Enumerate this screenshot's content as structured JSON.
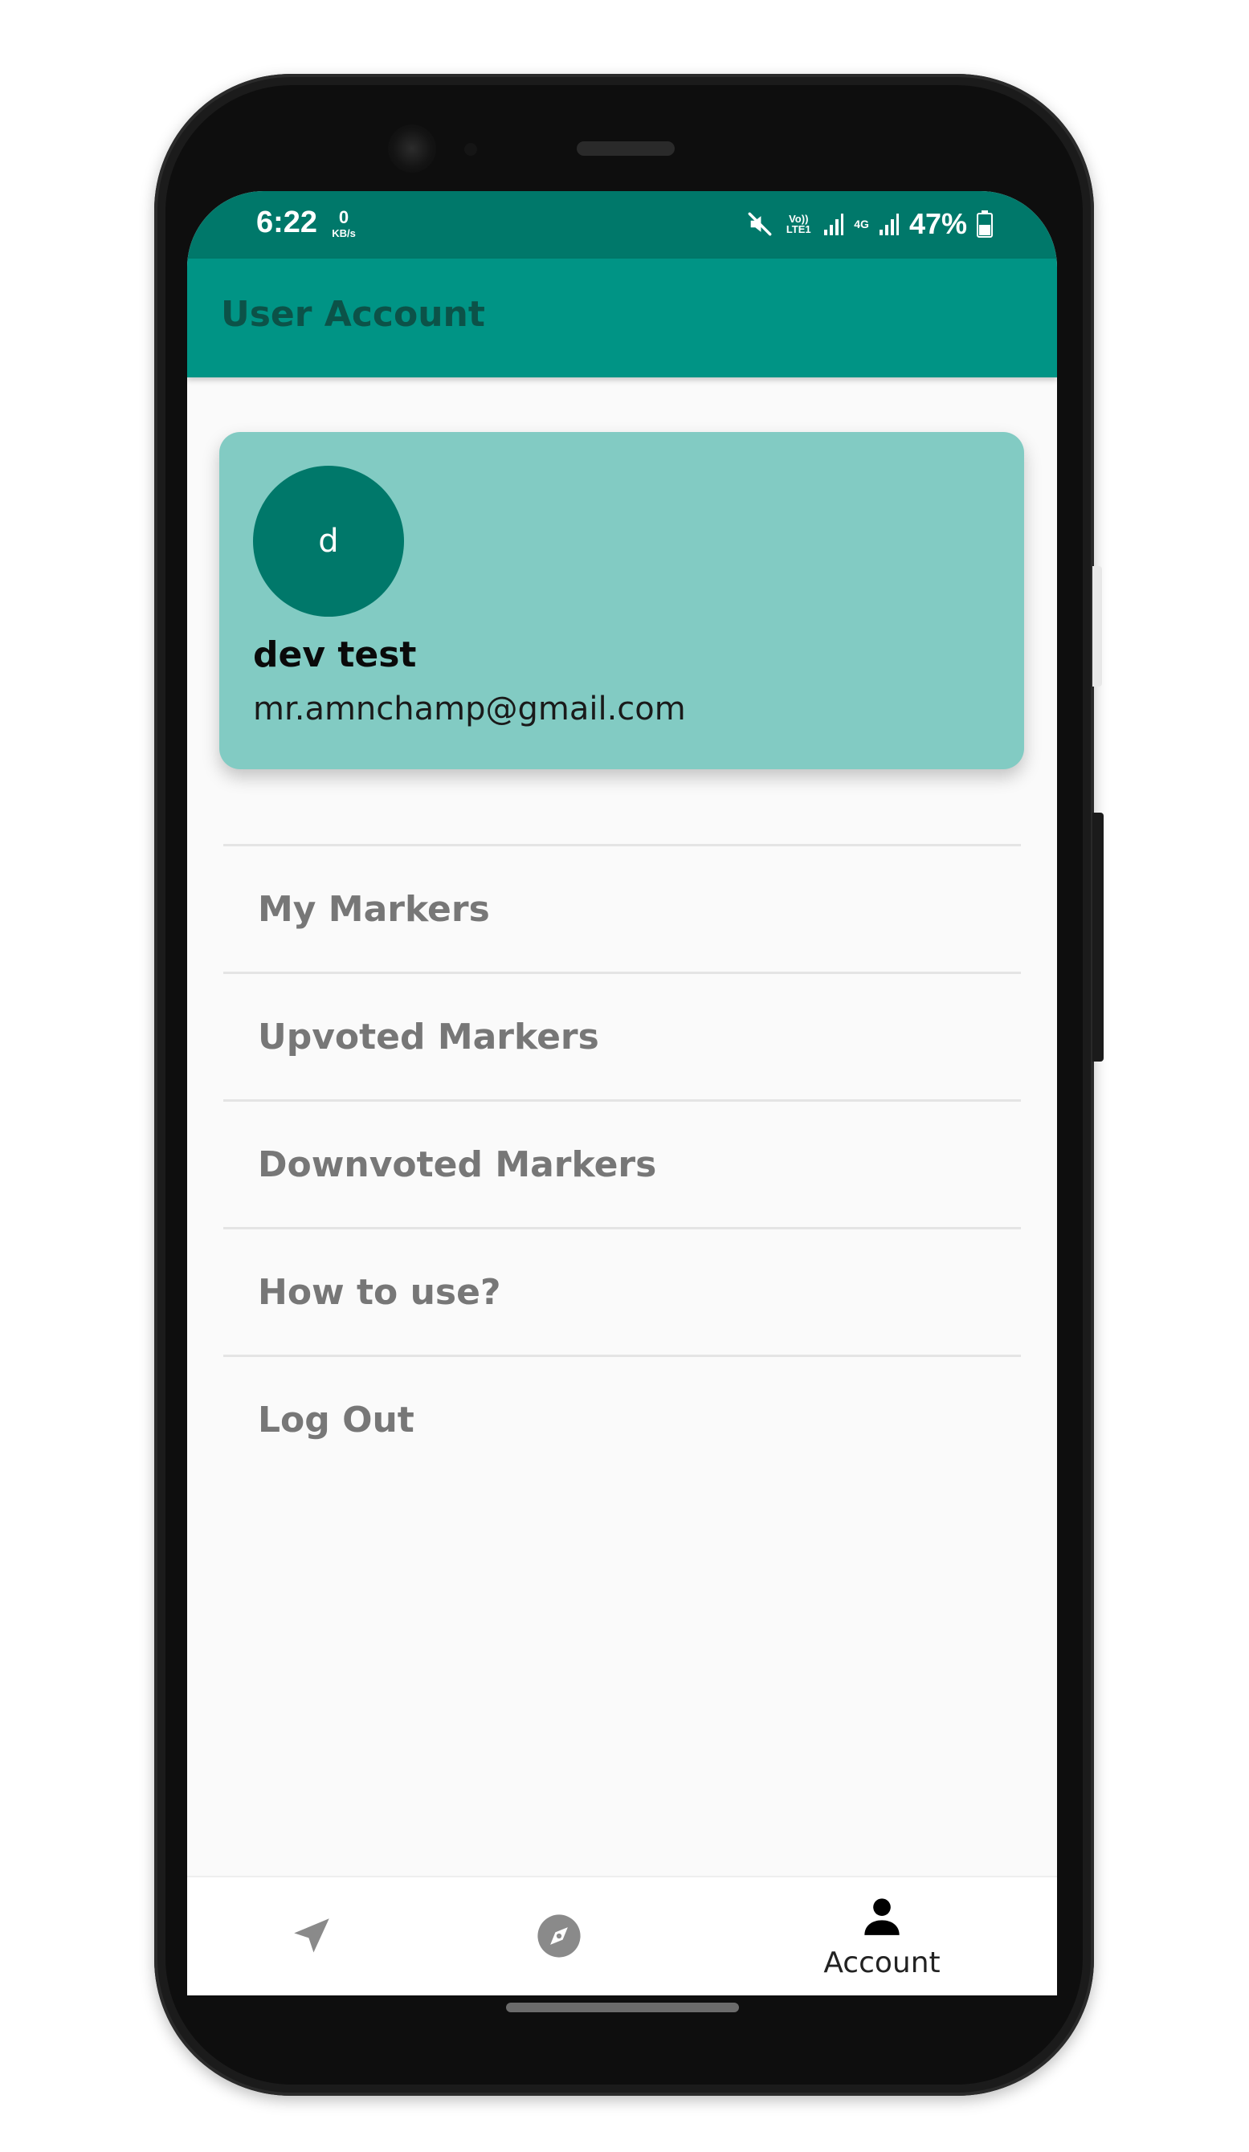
{
  "status_bar": {
    "time": "6:22",
    "net_speed_value": "0",
    "net_speed_unit": "KB/s",
    "volte_label": "Vo)) LTE1",
    "network_label": "4G",
    "battery": "47%"
  },
  "app_bar": {
    "title": "User Account"
  },
  "profile": {
    "avatar_letter": "d",
    "name": "dev test",
    "email": "mr.amnchamp@gmail.com"
  },
  "menu": {
    "items": [
      {
        "label": "My Markers"
      },
      {
        "label": "Upvoted Markers"
      },
      {
        "label": "Downvoted Markers"
      },
      {
        "label": "How to use?"
      },
      {
        "label": "Log Out"
      }
    ]
  },
  "bottom_nav": {
    "items": [
      {
        "icon": "navigation-arrow-icon",
        "label": ""
      },
      {
        "icon": "compass-icon",
        "label": ""
      },
      {
        "icon": "person-icon",
        "label": "Account"
      }
    ]
  },
  "colors": {
    "status_bar": "#00786a",
    "app_bar": "#009485",
    "card": "#82cbc3",
    "avatar": "#00786a",
    "menu_text": "#777777"
  }
}
